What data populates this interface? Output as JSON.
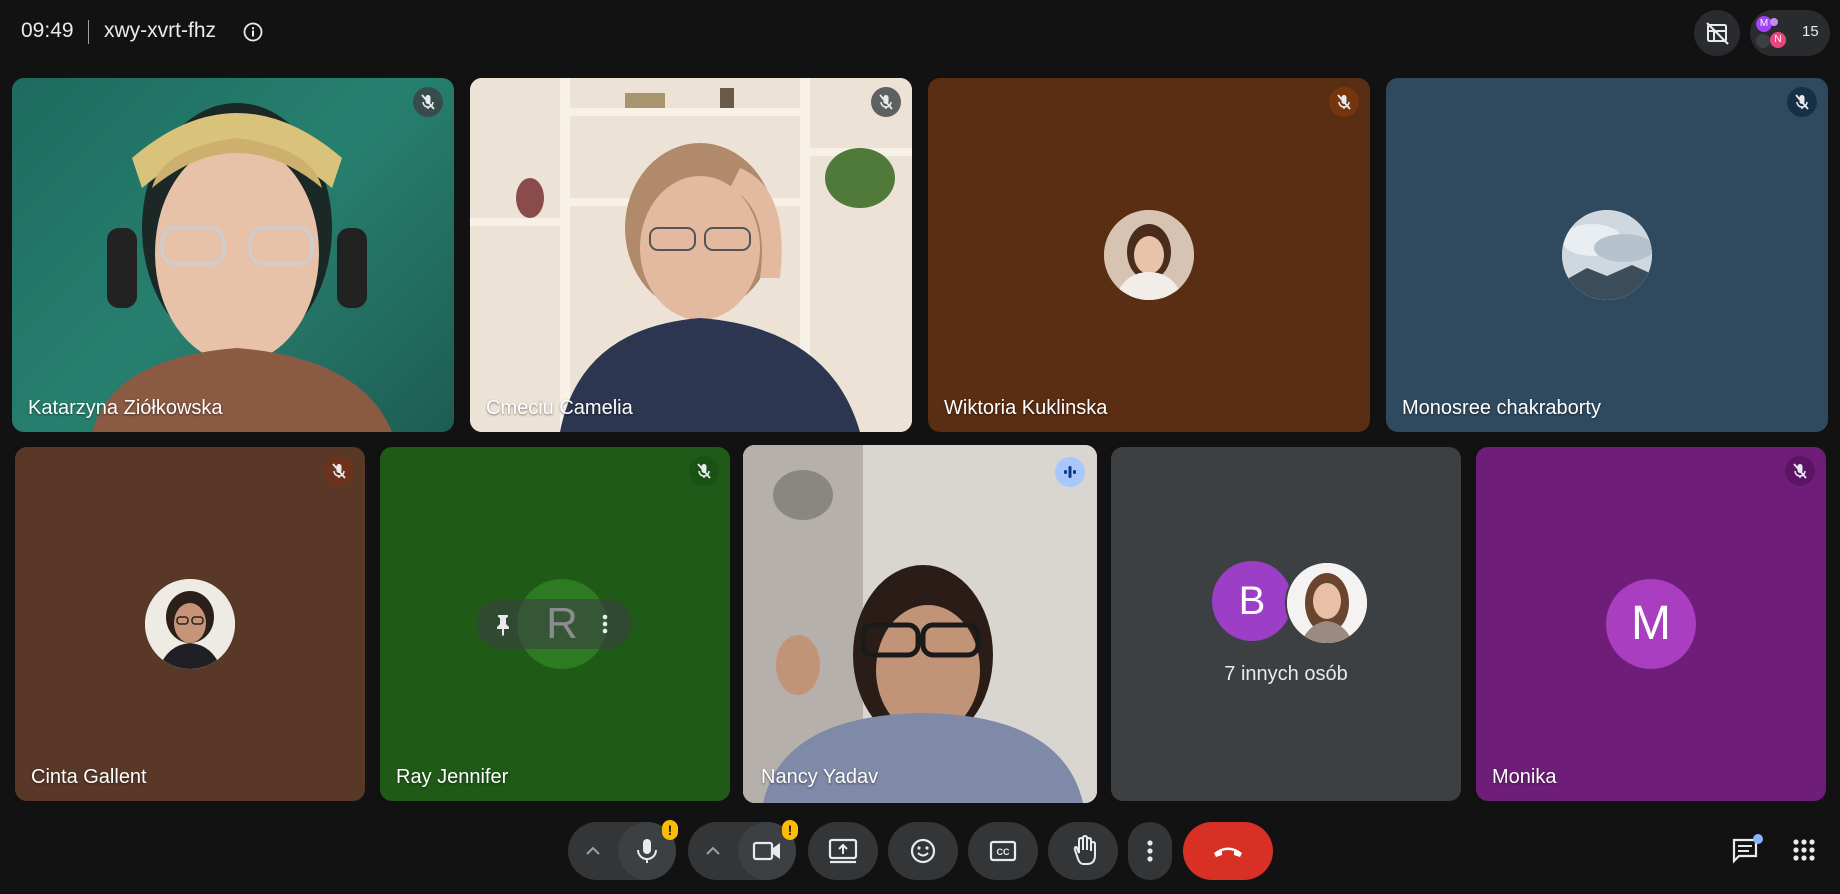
{
  "meeting": {
    "time": "09:49",
    "code": "xwy-xvrt-fhz",
    "participant_count": "15"
  },
  "chip_avatars": [
    "M",
    "N"
  ],
  "tiles": [
    {
      "name": "Katarzyna Ziółkowska",
      "muted": true,
      "video": "on"
    },
    {
      "name": "Cmeciu Camelia",
      "muted": true,
      "video": "on"
    },
    {
      "name": "Wiktoria Kuklinska",
      "muted": true,
      "video": "off"
    },
    {
      "name": "Monosree chakraborty",
      "muted": true,
      "video": "off"
    },
    {
      "name": "Cinta Gallent",
      "muted": true,
      "video": "off"
    },
    {
      "name": "Ray Jennifer",
      "muted": true,
      "video": "off",
      "avatar_letter": "R"
    },
    {
      "name": "Nancy Yadav",
      "muted": false,
      "speaking": true,
      "video": "on"
    },
    {
      "others_label": "7 innych osób",
      "avatar_letter": "B"
    },
    {
      "name": "Monika",
      "muted": true,
      "video": "off",
      "avatar_letter": "M"
    }
  ],
  "controls": {
    "mic_warning": "!",
    "cam_warning": "!"
  },
  "colors": {
    "background": "#121212",
    "hangup": "#d93025",
    "speaking_border": "#a8c7fa",
    "warning": "#fbbc04"
  }
}
